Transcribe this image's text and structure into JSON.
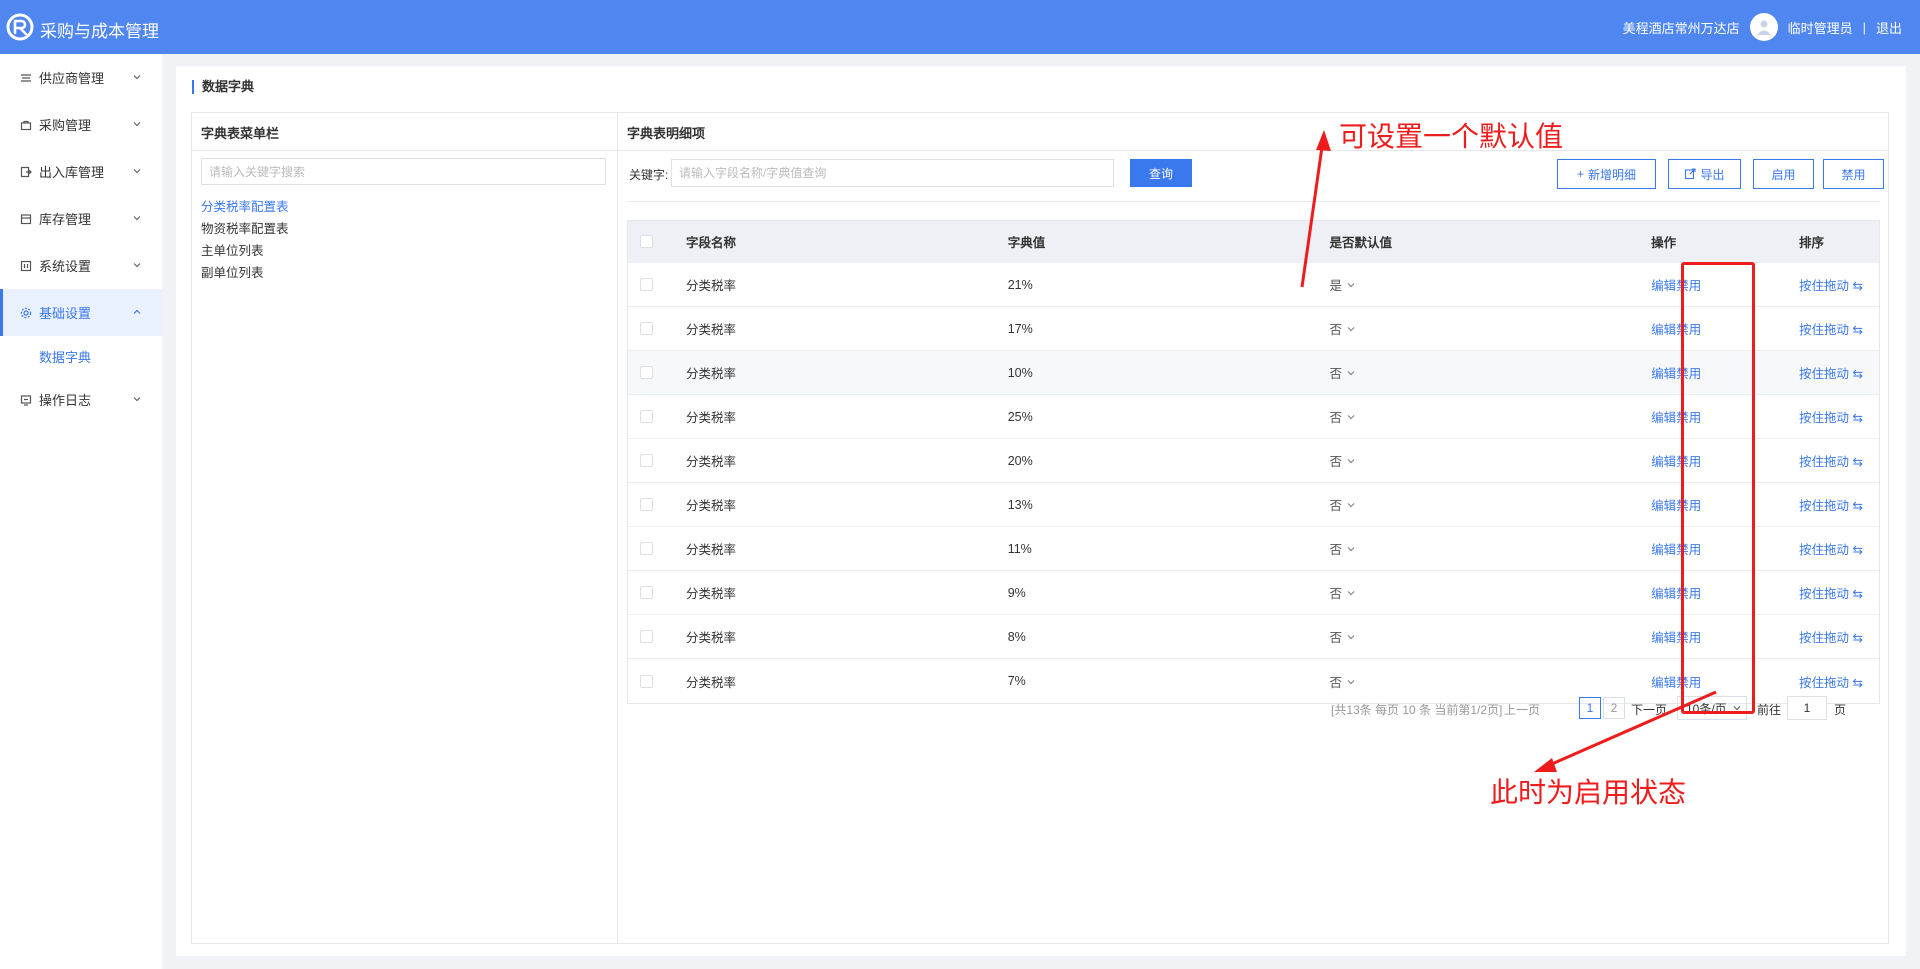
{
  "header": {
    "app_title": "采购与成本管理",
    "hotel": "美程酒店常州万达店",
    "user": "临时管理员",
    "separator": "|",
    "logout": "退出"
  },
  "sidebar": {
    "items": [
      {
        "label": "供应商管理",
        "icon": "supplier-icon"
      },
      {
        "label": "采购管理",
        "icon": "cart-icon"
      },
      {
        "label": "出入库管理",
        "icon": "inout-icon"
      },
      {
        "label": "库存管理",
        "icon": "inventory-icon"
      },
      {
        "label": "系统设置",
        "icon": "settings-panel-icon"
      },
      {
        "label": "基础设置",
        "icon": "gear-icon",
        "active": true
      },
      {
        "label": "操作日志",
        "icon": "log-icon"
      }
    ],
    "sub_item": "数据字典"
  },
  "page": {
    "title": "数据字典"
  },
  "left_panel": {
    "title": "字典表菜单栏",
    "search_placeholder": "请输入关键字搜索",
    "menu": [
      "分类税率配置表",
      "物资税率配置表",
      "主单位列表",
      "副单位列表"
    ],
    "selected_index": 0
  },
  "right_panel": {
    "title": "字典表明细项",
    "keyword_label": "关键字:",
    "keyword_placeholder": "请输入字段名称/字典值查询",
    "query_button": "查询",
    "add_button": "新增明细",
    "export_button": "导出",
    "enable_button": "启用",
    "disable_button": "禁用"
  },
  "table": {
    "columns": [
      "字段名称",
      "字典值",
      "是否默认值",
      "操作",
      "排序"
    ],
    "rows": [
      {
        "name": "分类税率",
        "value": "21%",
        "default": "是"
      },
      {
        "name": "分类税率",
        "value": "17%",
        "default": "否"
      },
      {
        "name": "分类税率",
        "value": "10%",
        "default": "否"
      },
      {
        "name": "分类税率",
        "value": "25%",
        "default": "否"
      },
      {
        "name": "分类税率",
        "value": "20%",
        "default": "否"
      },
      {
        "name": "分类税率",
        "value": "13%",
        "default": "否"
      },
      {
        "name": "分类税率",
        "value": "11%",
        "default": "否"
      },
      {
        "name": "分类税率",
        "value": "9%",
        "default": "否"
      },
      {
        "name": "分类税率",
        "value": "8%",
        "default": "否"
      },
      {
        "name": "分类税率",
        "value": "7%",
        "default": "否"
      }
    ],
    "edit_label": "编辑",
    "disable_label": "禁用",
    "sort_label": "按住拖动"
  },
  "pagination": {
    "info": "[共13条 每页 10 条 当前第1/2页]",
    "prev": "上一页",
    "pages": [
      "1",
      "2"
    ],
    "current_page": "1",
    "next": "下一页",
    "page_size": "10条/页",
    "goto_label": "前往",
    "goto_value": "1",
    "goto_unit": "页"
  },
  "annotations": {
    "default_note": "可设置一个默认值",
    "status_note": "此时为启用状态",
    "color": "#ee1c1c"
  },
  "colors": {
    "header_bg": "#4f86ef",
    "accent": "#3a78ee"
  }
}
